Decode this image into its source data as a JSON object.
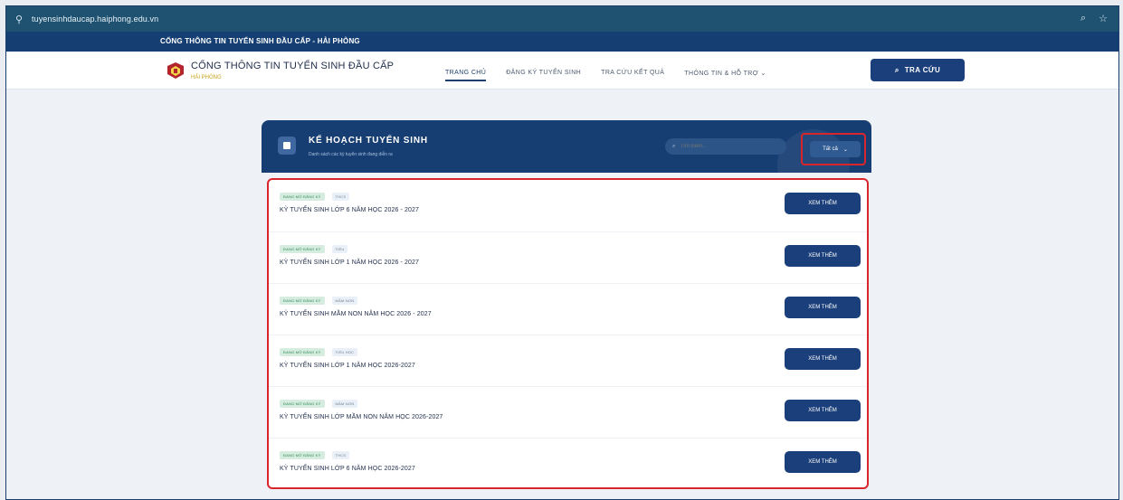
{
  "browser": {
    "url": "tuyensinhdaucap.haiphong.edu.vn"
  },
  "topstrip": {
    "text": "CỔNG THÔNG TIN TUYỂN SINH ĐẦU CẤP - HẢI PHÒNG"
  },
  "header": {
    "brand_title": "CỔNG THÔNG TIN TUYỂN SINH ĐẦU CẤP",
    "brand_sub": "HẢI PHÒNG",
    "nav": [
      {
        "label": "TRANG CHỦ",
        "active": true
      },
      {
        "label": "ĐĂNG KÝ TUYỂN SINH",
        "active": false
      },
      {
        "label": "TRA CỨU KẾT QUẢ",
        "active": false
      },
      {
        "label": "THÔNG TIN & HỖ TRỢ ⌄",
        "active": false
      }
    ],
    "search_button": "TRA CỨU"
  },
  "panel": {
    "title": "KẾ HOẠCH TUYỂN SINH",
    "subtitle": "Danh sách các kỳ tuyển sinh đang diễn ra",
    "search_placeholder": "Tìm kiếm...",
    "filter_label": "Tất cả"
  },
  "items": [
    {
      "status": "ĐANG MỞ ĐĂNG KÝ",
      "level": "THCS",
      "title": "KỲ TUYỂN SINH LỚP 6 NĂM HỌC 2026 - 2027",
      "button": "XEM THÊM"
    },
    {
      "status": "ĐANG MỞ ĐĂNG KÝ",
      "level": "TIỂU",
      "title": "KỲ TUYỂN SINH LỚP 1 NĂM HỌC 2026 - 2027",
      "button": "XEM THÊM"
    },
    {
      "status": "ĐANG MỞ ĐĂNG KÝ",
      "level": "MẦM NON",
      "title": "KỲ TUYỂN SINH MẦM NON NĂM HỌC 2026 - 2027",
      "button": "XEM THÊM"
    },
    {
      "status": "ĐANG MỞ ĐĂNG KÝ",
      "level": "TIỂU HỌC",
      "title": "KỲ TUYỂN SINH LỚP 1 NĂM HỌC 2026-2027",
      "button": "XEM THÊM"
    },
    {
      "status": "ĐANG MỞ ĐĂNG KÝ",
      "level": "MẦM NON",
      "title": "KỲ TUYỂN SINH LỚP MẦM NON NĂM HỌC 2026-2027",
      "button": "XEM THÊM"
    },
    {
      "status": "ĐANG MỞ ĐĂNG KÝ",
      "level": "THCS",
      "title": "KỲ TUYỂN SINH LỚP 6 NĂM HỌC 2026-2027",
      "button": "XEM THÊM"
    }
  ]
}
